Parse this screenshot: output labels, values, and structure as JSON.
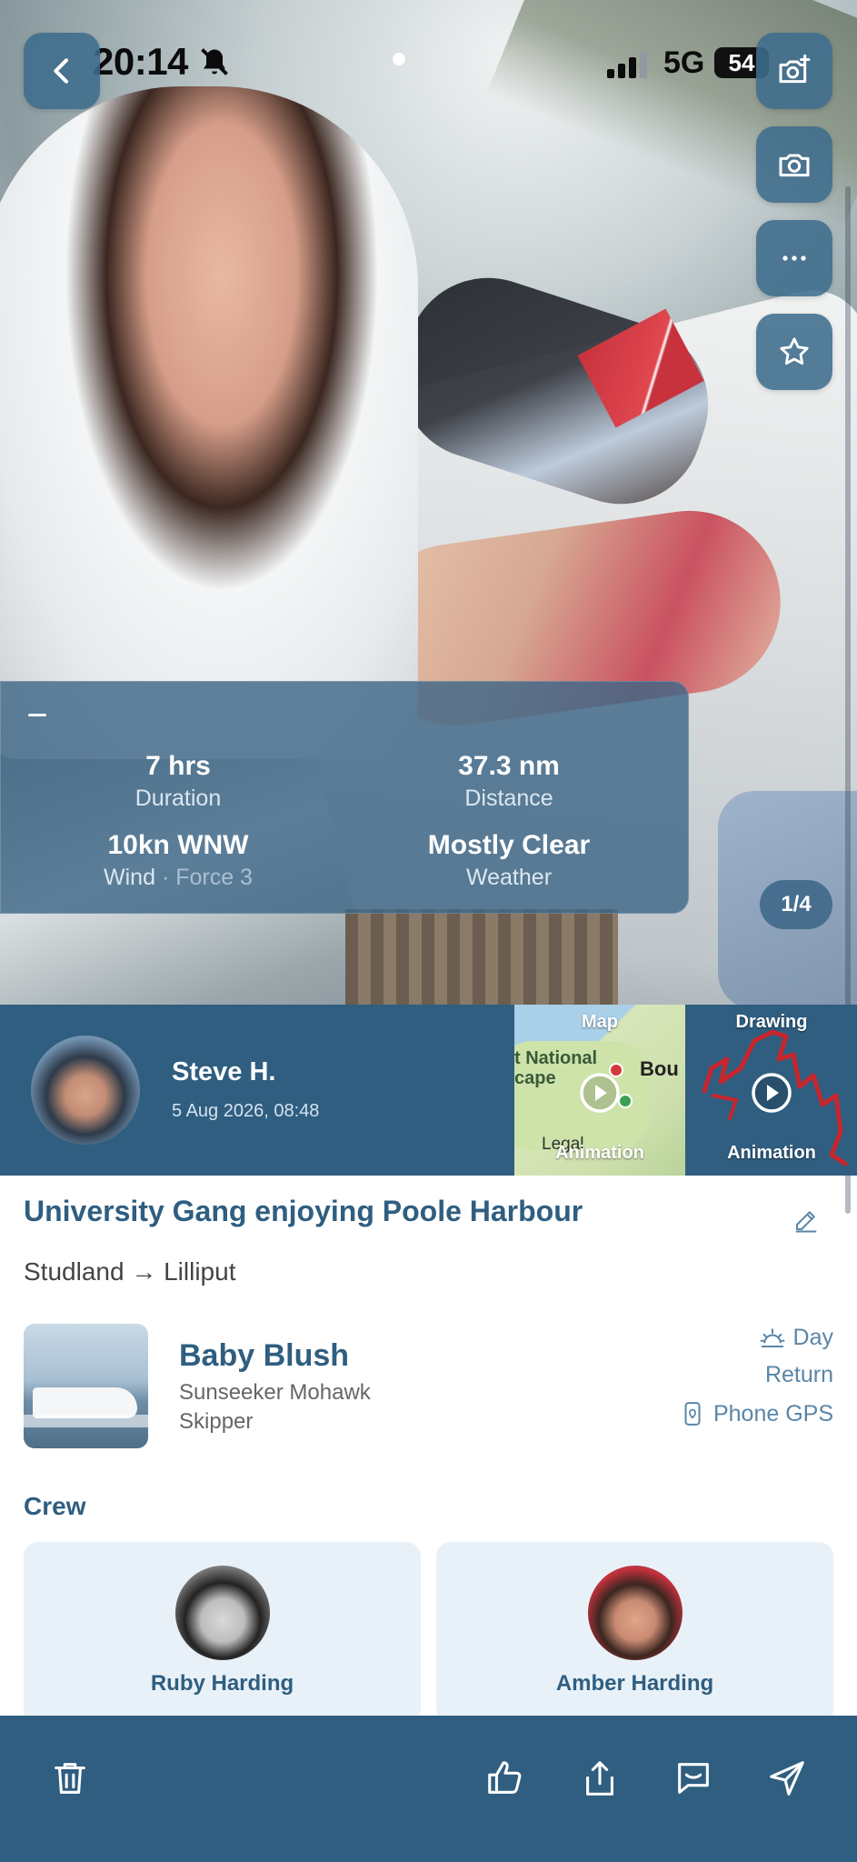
{
  "status_bar": {
    "time": "20:14",
    "network": "5G",
    "battery": "54"
  },
  "hero": {
    "photo_subject": "group on a speedboat",
    "page_indicator": "1/4"
  },
  "stats": {
    "duration": {
      "value": "7 hrs",
      "label": "Duration"
    },
    "distance": {
      "value": "37.3 nm",
      "label": "Distance"
    },
    "wind": {
      "value": "10kn WNW",
      "label": "Wind",
      "extra": "· Force 3"
    },
    "weather": {
      "value": "Mostly Clear",
      "label": "Weather"
    }
  },
  "author": {
    "name": "Steve H.",
    "date": "5 Aug 2026, 08:48"
  },
  "tiles": {
    "map": {
      "title": "Map",
      "subtitle": "Animation",
      "label_place": "t National\ncape",
      "label_town": "Bou",
      "label_legal": "Legal"
    },
    "drawing": {
      "title": "Drawing",
      "subtitle": "Animation"
    }
  },
  "trip": {
    "title": "University Gang enjoying Poole Harbour",
    "route": "Studland → Lilliput"
  },
  "boat": {
    "name": "Baby Blush",
    "model": "Sunseeker Mohawk",
    "role": "Skipper"
  },
  "meta": {
    "time_of_day": "Day",
    "trip_type": "Return",
    "source": "Phone GPS"
  },
  "crew": {
    "heading": "Crew",
    "members": [
      {
        "name": "Ruby Harding"
      },
      {
        "name": "Amber Harding"
      }
    ]
  },
  "colors": {
    "brand_dark": "#2f5e80",
    "brand_panel": "#3f6888",
    "accent_text": "#5a86a8",
    "card_bg": "#e8f1f8"
  },
  "icons": [
    "back-icon",
    "camera-add-icon",
    "camera-flip-icon",
    "more-icon",
    "star-icon",
    "edit-icon",
    "sunrise-icon",
    "phone-gps-icon",
    "play-icon",
    "trash-icon",
    "thumbs-up-icon",
    "share-icon",
    "comment-icon",
    "send-icon"
  ]
}
